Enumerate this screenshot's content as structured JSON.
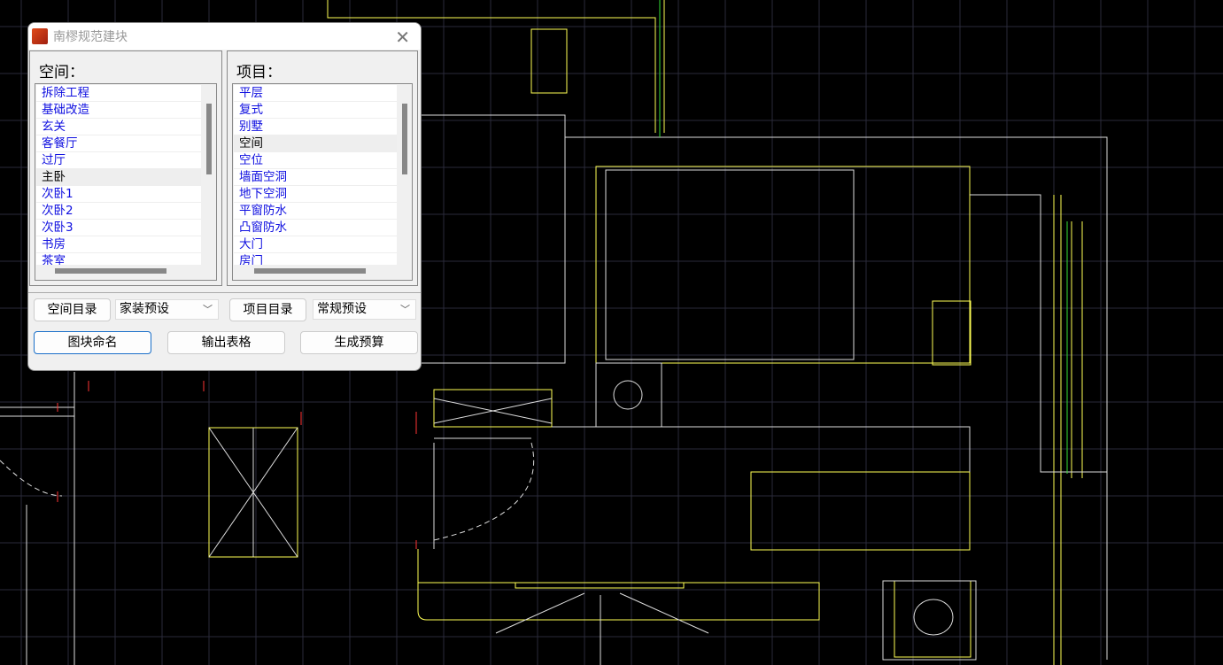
{
  "dialog": {
    "title": "南樛规范建块",
    "space_panel": {
      "label": "空间：",
      "items": [
        "拆除工程",
        "基础改造",
        "玄关",
        "客餐厅",
        "过厅",
        "主卧",
        "次卧1",
        "次卧2",
        "次卧3",
        "书房",
        "茶室"
      ],
      "selected": "主卧"
    },
    "item_panel": {
      "label": "项目：",
      "items": [
        "平层",
        "复式",
        "别墅",
        "空间",
        "空位",
        "墙面空洞",
        "地下空洞",
        "平窗防水",
        "凸窗防水",
        "大门",
        "房门"
      ],
      "selected": "空间"
    },
    "buttons": {
      "space_catalog": "空间目录",
      "space_preset": "家装预设",
      "item_catalog": "项目目录",
      "item_preset": "常规预设",
      "block_naming": "图块命名",
      "export_table": "输出表格",
      "generate_budget": "生成预算"
    }
  }
}
